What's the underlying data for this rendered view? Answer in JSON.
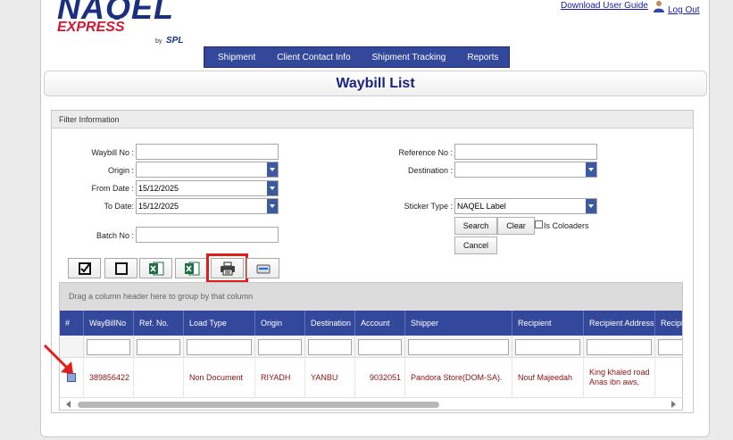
{
  "brand": {
    "name": "NAQEL",
    "sub": "EXPRESS",
    "by": "by",
    "parent": "SPL"
  },
  "toplinks": {
    "download": "Download User Guide",
    "logout": "Log Out"
  },
  "menu": [
    "Shipment",
    "Client Contact Info",
    "Shipment Tracking",
    "Reports"
  ],
  "page_title": "Waybill List",
  "filter": {
    "heading": "Filter Information",
    "waybill_label": "Waybill No :",
    "waybill_value": "",
    "origin_label": "Origin :",
    "origin_value": "",
    "from_label": "From Date :",
    "from_value": "15/12/2025",
    "to_label": "To Date:",
    "to_value": "15/12/2025",
    "batch_label": "Batch No :",
    "batch_value": "",
    "reference_label": "Reference No :",
    "reference_value": "",
    "destination_label": "Destination :",
    "destination_value": "",
    "sticker_label": "Sticker Type :",
    "sticker_value": "NAQEL Label",
    "search_btn": "Search",
    "clear_btn": "Clear",
    "reset_btn": "Cancel",
    "coloaders_label": "Is Coloaders"
  },
  "toolbar": [
    "check-all-icon",
    "uncheck-all-icon",
    "excel-export-icon",
    "excel-export-alt-icon",
    "printer-icon",
    "scanner-icon"
  ],
  "grid": {
    "group_hint": "Drag a column header here to group by that column",
    "columns": [
      "#",
      "WayBillNo",
      "Ref. No.",
      "Load Type",
      "Origin",
      "Destination",
      "Account",
      "Shipper",
      "Recipient",
      "Recipient Address",
      "Recipi"
    ],
    "rows": [
      {
        "waybill": "389856422",
        "ref": "",
        "load_type": "Non Document",
        "origin": "RIYADH",
        "destination": "YANBU",
        "account": "9032051",
        "shipper": "Pandora Store(DOM-SA).",
        "recipient": "Nouf Majeedah",
        "address": "King khaled road Anas ibn aws,",
        "extra": ""
      }
    ]
  },
  "colors": {
    "accent": "#34489b",
    "title": "#1b2380",
    "brand_red": "#d3192f",
    "highlight": "#e31b1b",
    "cell_text": "#8a1212"
  }
}
